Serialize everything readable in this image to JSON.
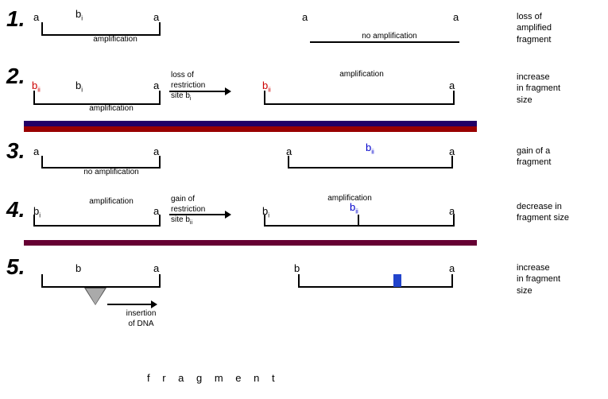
{
  "rows": [
    {
      "number": "1.",
      "desc": "loss of\namplified\nfragment"
    },
    {
      "number": "2.",
      "desc": "increase\nin fragment\nsize"
    },
    {
      "number": "3.",
      "desc": "gain of a\nfragment"
    },
    {
      "number": "4.",
      "desc": "decrease in\nfragment size"
    },
    {
      "number": "5.",
      "desc": "increase\nin fragment\nsize"
    }
  ],
  "labels": {
    "a": "a",
    "b": "b",
    "bi": "b",
    "bi_sub": "i",
    "bii": "b",
    "bii_sub": "ii",
    "amplification": "amplification",
    "no_amplification": "no amplification",
    "loss_restriction": "loss of\nrestriction\nsite b",
    "gain_restriction": "gain of\nrestriction\nsite b",
    "insertion_dna": "insertion\nof DNA",
    "fragment": "f r a g m e n t"
  }
}
